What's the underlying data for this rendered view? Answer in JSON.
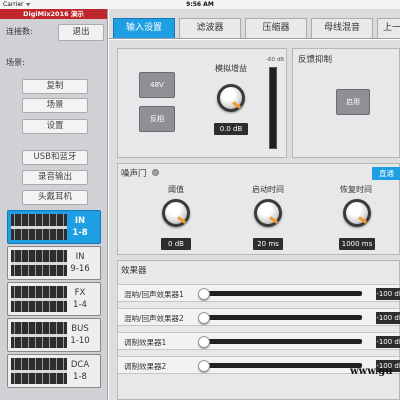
{
  "status_bar": {
    "carrier": "Carrier ᯤ",
    "time": "9:56 AM"
  },
  "sidebar": {
    "app_title": "DigiMix2016 演示",
    "connection_label": "连接数:",
    "logout_label": "退出",
    "scene_label": "场景:",
    "buttons": [
      "复制",
      "场景",
      "设置",
      "USB和蓝牙",
      "录音输出",
      "头戴耳机"
    ],
    "banks": [
      {
        "name": "IN",
        "range": "1-8",
        "active": true
      },
      {
        "name": "IN",
        "range": "9-16",
        "active": false
      },
      {
        "name": "FX",
        "range": "1-4",
        "active": false
      },
      {
        "name": "BUS",
        "range": "1-10",
        "active": false
      },
      {
        "name": "DCA",
        "range": "1-8",
        "active": false
      }
    ]
  },
  "tabs": [
    "输入设置",
    "滤波器",
    "压缩器",
    "母线混音",
    "上一"
  ],
  "active_tab": 0,
  "input_panel": {
    "phantom_label": "48V",
    "invert_label": "反相",
    "gain_label": "模拟增益",
    "gain_value": "0.0 dB",
    "meter_top_label": "-60 dB"
  },
  "feedback": {
    "title": "反馈抑制",
    "enable_label": "启用"
  },
  "gate": {
    "title": "噪声门",
    "bypass_label": "直通",
    "threshold_label": "阈值",
    "threshold_value": "0 dB",
    "attack_label": "启动时间",
    "attack_value": "20 ms",
    "release_label": "恢复时间",
    "release_value": "1000 ms"
  },
  "effects": {
    "title": "效果器",
    "rows": [
      {
        "name": "混响/回声效果器1",
        "value": "-100 dB"
      },
      {
        "name": "混响/回声效果器2",
        "value": "-100 dB"
      },
      {
        "name": "调制效果器1",
        "value": "-100 dB"
      },
      {
        "name": "调制效果器2",
        "value": "-100 dB"
      }
    ]
  },
  "watermark": "www.gu",
  "colors": {
    "accent": "#1e9fe3",
    "brand": "#c0272d",
    "knob_indicator": "#f29b2c"
  }
}
